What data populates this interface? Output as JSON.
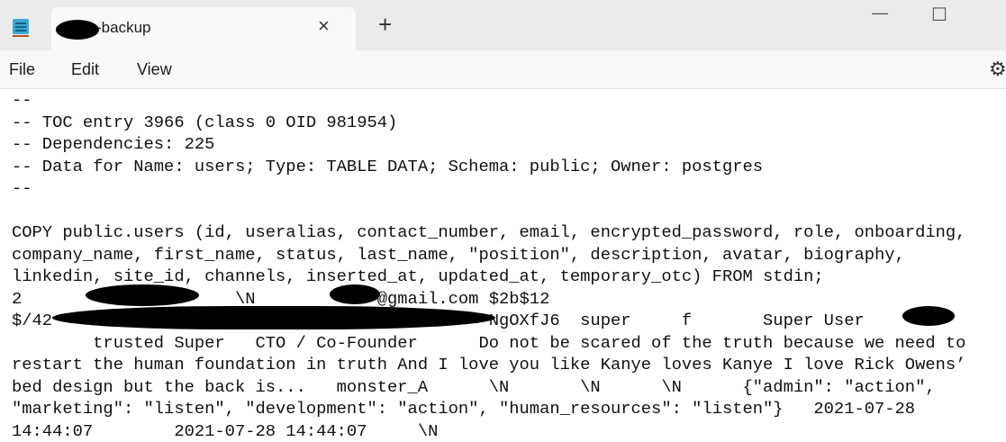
{
  "window": {
    "tab_title": "-backup",
    "new_tab": "+",
    "close_tab": "×",
    "minimize": "—",
    "maximize": "☐"
  },
  "menu": {
    "file": "File",
    "edit": "Edit",
    "view": "View"
  },
  "icons": {
    "app": "notepad-icon",
    "settings": "gear-icon"
  },
  "editor": {
    "lines": [
      "--",
      "-- TOC entry 3966 (class 0 OID 981954)",
      "-- Dependencies: 225",
      "-- Data for Name: users; Type: TABLE DATA; Schema: public; Owner: postgres",
      "--",
      "",
      "COPY public.users (id, useralias, contact_number, email, encrypted_password, role, onboarding,",
      "company_name, first_name, status, last_name, \"position\", description, avatar, biography,",
      "linkedin, site_id, channels, inserted_at, updated_at, temporary_otc) FROM stdin;",
      "2                     \\N            @gmail.com $2b$12",
      "$/42                                           NgOXfJ6  super     f       Super User",
      "        trusted Super   CTO / Co-Founder      Do not be scared of the truth because we need to",
      "restart the human foundation in truth And I love you like Kanye loves Kanye I love Rick Owens’",
      "bed design but the back is...   monster_A      \\N       \\N      \\N      {\"admin\": \"action\",",
      "\"marketing\": \"listen\", \"development\": \"action\", \"human_resources\": \"listen\"}   2021-07-28",
      "14:44:07        2021-07-28 14:44:07     \\N"
    ]
  }
}
